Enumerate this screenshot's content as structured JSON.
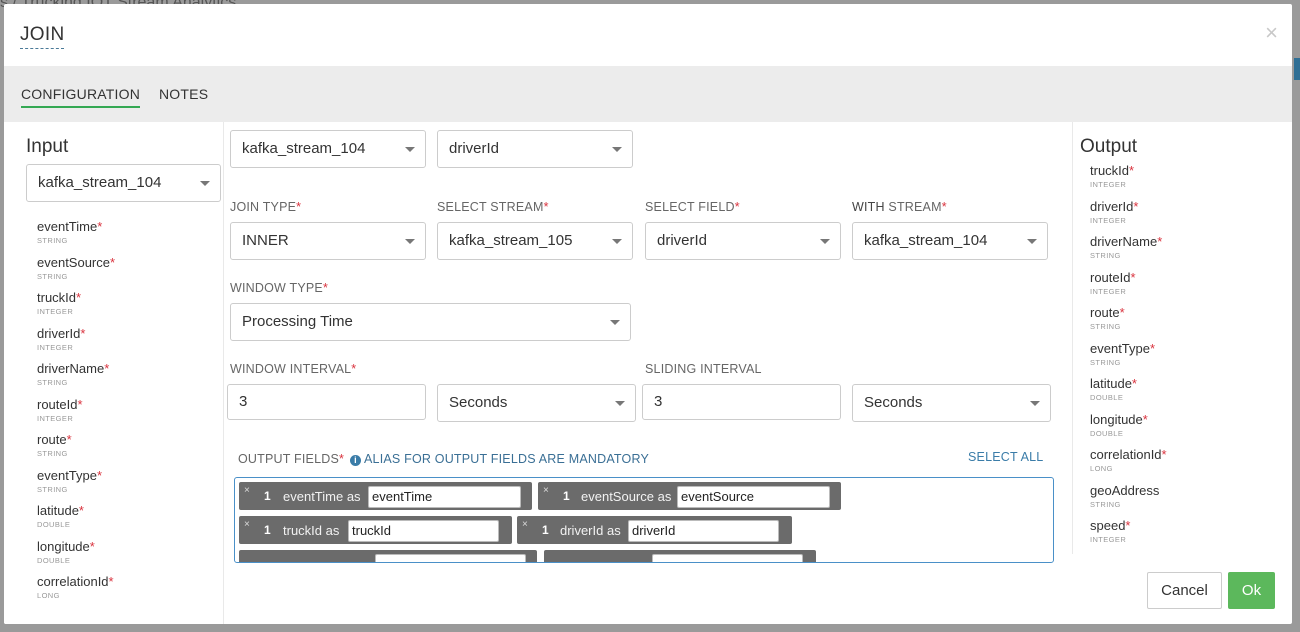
{
  "backdrop": {
    "breadcrumb": "s / Trucking IOT Stream Analytics"
  },
  "modal": {
    "title": "JOIN",
    "close_symbol": "×"
  },
  "tabs": [
    {
      "label": "CONFIGURATION",
      "active": true
    },
    {
      "label": "NOTES",
      "active": false
    }
  ],
  "input": {
    "heading": "Input",
    "stream_select": "kafka_stream_104",
    "fields": [
      {
        "name": "eventTime",
        "type": "STRING",
        "required": "*"
      },
      {
        "name": "eventSource",
        "type": "STRING",
        "required": "*"
      },
      {
        "name": "truckId",
        "type": "INTEGER",
        "required": "*"
      },
      {
        "name": "driverId",
        "type": "INTEGER",
        "required": "*"
      },
      {
        "name": "driverName",
        "type": "STRING",
        "required": "*"
      },
      {
        "name": "routeId",
        "type": "INTEGER",
        "required": "*"
      },
      {
        "name": "route",
        "type": "STRING",
        "required": "*"
      },
      {
        "name": "eventType",
        "type": "STRING",
        "required": "*"
      },
      {
        "name": "latitude",
        "type": "DOUBLE",
        "required": "*"
      },
      {
        "name": "longitude",
        "type": "DOUBLE",
        "required": "*"
      },
      {
        "name": "correlationId",
        "type": "LONG",
        "required": "*"
      }
    ]
  },
  "config": {
    "from_stream": "kafka_stream_104",
    "from_field": "driverId",
    "join_type_label": "JOIN TYPE",
    "join_type_value": "INNER",
    "select_stream_label": "SELECT STREAM",
    "select_stream_value": "kafka_stream_105",
    "select_field_label": "SELECT FIELD",
    "select_field_value": "driverId",
    "with_stream_label_bold": "WITH",
    "with_stream_label_rest": " STREAM",
    "with_stream_value": "kafka_stream_104",
    "window_type_label": "WINDOW TYPE",
    "window_type_value": "Processing Time",
    "window_interval_label": "WINDOW INTERVAL",
    "window_interval_value": "3",
    "window_interval_unit": "Seconds",
    "sliding_interval_label": "SLIDING INTERVAL",
    "sliding_interval_value": "3",
    "sliding_interval_unit": "Seconds",
    "required_marker": "*",
    "output_fields_label": "OUTPUT FIELDS",
    "info_icon_glyph": "i",
    "alias_note": "ALIAS FOR OUTPUT FIELDS ARE MANDATORY",
    "select_all": "SELECT ALL",
    "tag_remove_symbol": "×",
    "tags": [
      {
        "stream_no": "1",
        "field": "eventTime as",
        "alias": "eventTime"
      },
      {
        "stream_no": "1",
        "field": "eventSource as",
        "alias": "eventSource"
      },
      {
        "stream_no": "1",
        "field": "truckId as",
        "alias": "truckId"
      },
      {
        "stream_no": "1",
        "field": "driverId as",
        "alias": "driverId"
      }
    ]
  },
  "output": {
    "heading": "Output",
    "fields": [
      {
        "name": "truckId",
        "type": "INTEGER",
        "required": "*"
      },
      {
        "name": "driverId",
        "type": "INTEGER",
        "required": "*"
      },
      {
        "name": "driverName",
        "type": "STRING",
        "required": "*"
      },
      {
        "name": "routeId",
        "type": "INTEGER",
        "required": "*"
      },
      {
        "name": "route",
        "type": "STRING",
        "required": "*"
      },
      {
        "name": "eventType",
        "type": "STRING",
        "required": "*"
      },
      {
        "name": "latitude",
        "type": "DOUBLE",
        "required": "*"
      },
      {
        "name": "longitude",
        "type": "DOUBLE",
        "required": "*"
      },
      {
        "name": "correlationId",
        "type": "LONG",
        "required": "*"
      },
      {
        "name": "geoAddress",
        "type": "STRING",
        "required": ""
      },
      {
        "name": "speed",
        "type": "INTEGER",
        "required": "*"
      }
    ]
  },
  "footer": {
    "cancel": "Cancel",
    "ok": "Ok"
  },
  "colors": {
    "accent_green": "#5cb85c",
    "tab_underline": "#34a853",
    "link_blue": "#3a7ca8",
    "required_red": "#d9323d"
  }
}
